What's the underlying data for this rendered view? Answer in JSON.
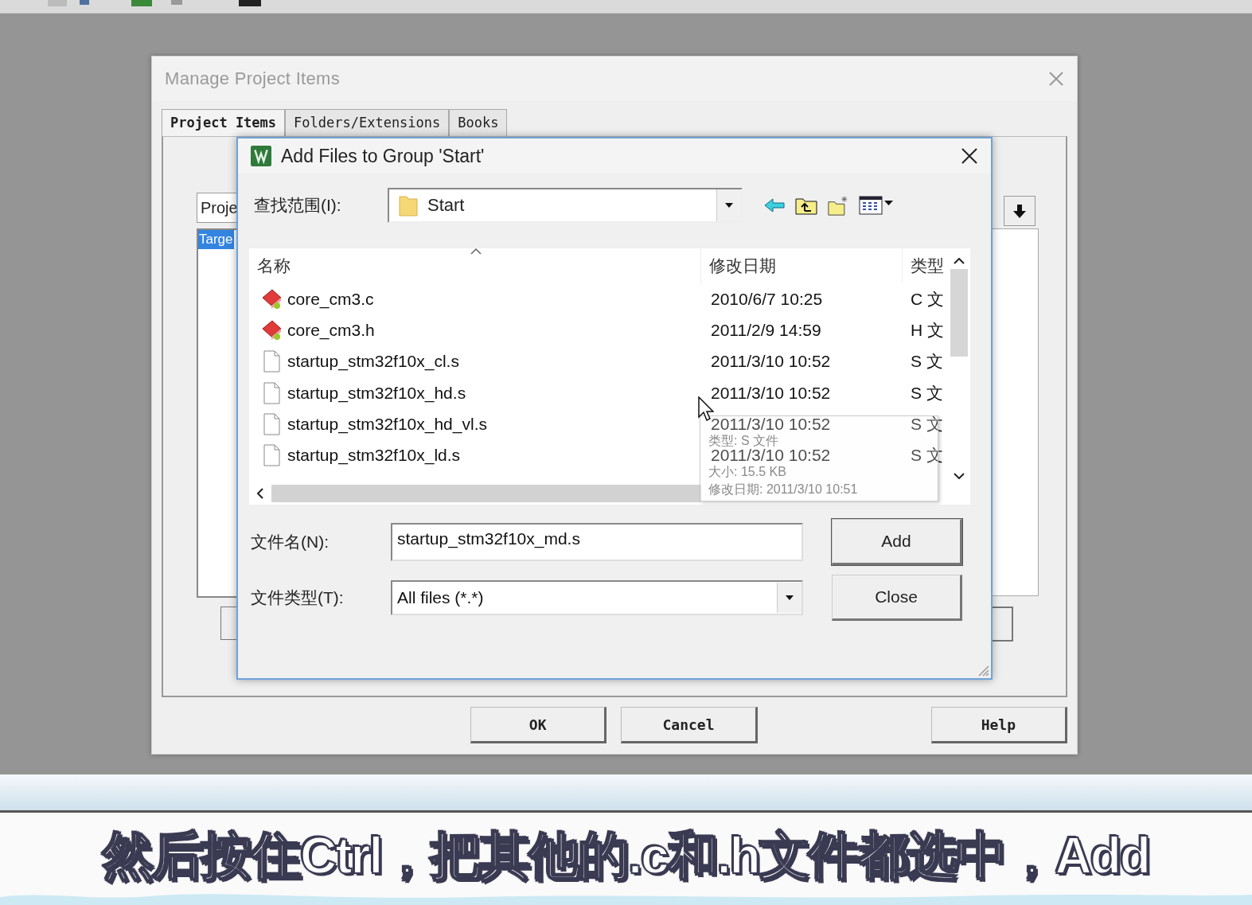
{
  "manage_dialog": {
    "title": "Manage Project Items",
    "tabs": [
      {
        "label": "Project Items",
        "selected": true
      },
      {
        "label": "Folders/Extensions",
        "selected": false
      },
      {
        "label": "Books",
        "selected": false
      }
    ],
    "group_field": "Proje",
    "list_items": [
      {
        "label": "Targe",
        "selected": true
      }
    ],
    "buttons": [
      "OK",
      "Cancel",
      "Help"
    ]
  },
  "add_dialog": {
    "title": "Add Files to Group 'Start'",
    "look_in_label": "查找范围(I):",
    "look_in_value": "Start",
    "columns": [
      "名称",
      "修改日期",
      "类型"
    ],
    "files": [
      {
        "name": "core_cm3.c",
        "kind": "source",
        "date": "2010/6/7 10:25",
        "type": "C 文"
      },
      {
        "name": "core_cm3.h",
        "kind": "source",
        "date": "2011/2/9 14:59",
        "type": "H 文"
      },
      {
        "name": "startup_stm32f10x_cl.s",
        "kind": "plain",
        "date": "2011/3/10 10:52",
        "type": "S 文"
      },
      {
        "name": "startup_stm32f10x_hd.s",
        "kind": "plain",
        "date": "2011/3/10 10:52",
        "type": "S 文"
      },
      {
        "name": "startup_stm32f10x_hd_vl.s",
        "kind": "plain",
        "date": "2011/3/10 10:52",
        "type": "S 文"
      },
      {
        "name": "startup_stm32f10x_ld.s",
        "kind": "plain",
        "date": "2011/3/10 10:52",
        "type": "S 文"
      }
    ],
    "tooltip": [
      "类型: S 文件",
      "大小: 15.5 KB",
      "修改日期: 2011/3/10 10:51"
    ],
    "file_name_label": "文件名(N):",
    "file_name_value": "startup_stm32f10x_md.s",
    "file_type_label": "文件类型(T):",
    "file_type_value": "All files (*.*)",
    "buttons": [
      "Add",
      "Close"
    ]
  },
  "subtitle": "然后按住Ctrl，把其他的.c和.h文件都选中，Add"
}
